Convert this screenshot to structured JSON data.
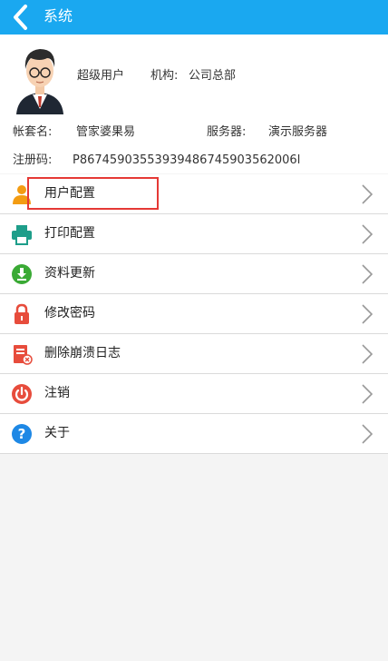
{
  "header": {
    "title": "系统"
  },
  "profile": {
    "user_role": "超级用户",
    "org_label": "机构:",
    "org_value": "公司总部",
    "account_label": "帐套名:",
    "account_value": "管家婆果易",
    "server_label": "服务器:",
    "server_value": "演示服务器",
    "reg_label": "注册码:",
    "reg_value": "P86745903553939486745903562006l"
  },
  "menu": [
    {
      "label": "用户配置",
      "icon": "user-icon",
      "color": "#f39c12"
    },
    {
      "label": "打印配置",
      "icon": "printer-icon",
      "color": "#1e9e8a"
    },
    {
      "label": "资料更新",
      "icon": "download-icon",
      "color": "#3aaa35"
    },
    {
      "label": "修改密码",
      "icon": "lock-icon",
      "color": "#e74c3c"
    },
    {
      "label": "删除崩溃日志",
      "icon": "delete-log-icon",
      "color": "#e74c3c"
    },
    {
      "label": "注销",
      "icon": "power-icon",
      "color": "#e74c3c"
    },
    {
      "label": "关于",
      "icon": "help-icon",
      "color": "#1e88e5"
    }
  ],
  "colors": {
    "accent": "#1aa8f0",
    "highlight": "#e53935"
  }
}
